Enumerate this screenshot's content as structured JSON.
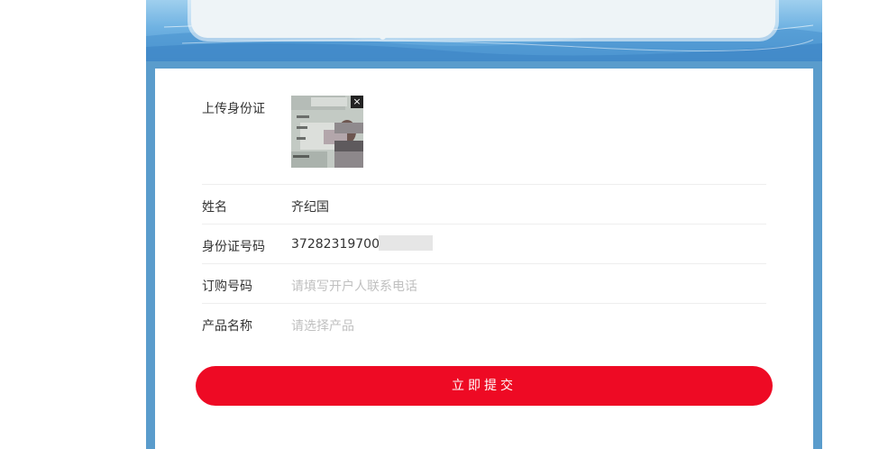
{
  "form": {
    "upload_label": "上传身份证",
    "name_label": "姓名",
    "name_value": "齐纪国",
    "idnum_label": "身份证号码",
    "idnum_value": "37282319700",
    "order_label": "订购号码",
    "order_placeholder": "请填写开户人联系电话",
    "product_label": "产品名称",
    "product_placeholder": "请选择产品",
    "remove_symbol": "×"
  },
  "submit": {
    "label": "立即提交"
  },
  "colors": {
    "accent": "#ee0a24",
    "frame": "#5a9ccc"
  },
  "icons": {
    "remove": "close-icon"
  }
}
